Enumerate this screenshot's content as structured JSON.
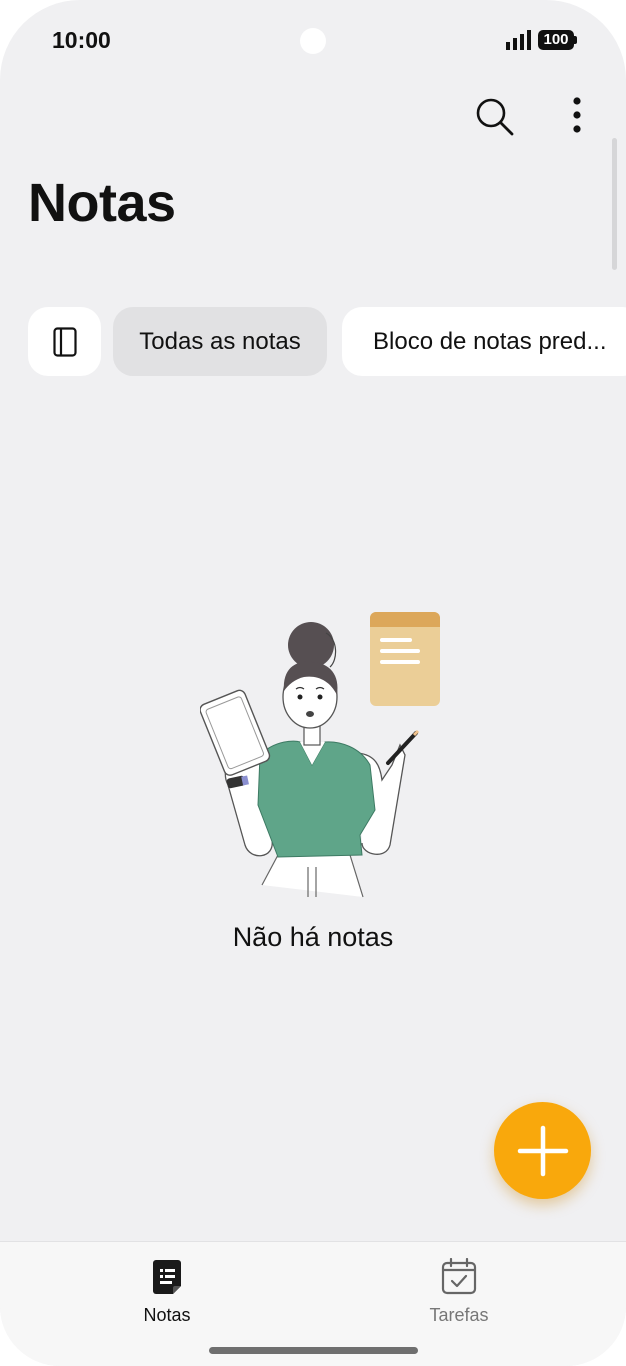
{
  "status": {
    "time": "10:00",
    "battery": "100"
  },
  "header": {
    "title": "Notas"
  },
  "filters": {
    "all_notes": "Todas as notas",
    "default_notebook": "Bloco de notas pred..."
  },
  "empty_state": {
    "message": "Não há notas"
  },
  "bottom_nav": {
    "items": [
      {
        "label": "Notas",
        "icon": "note-icon",
        "active": true
      },
      {
        "label": "Tarefas",
        "icon": "calendar-check-icon",
        "active": false
      }
    ]
  },
  "colors": {
    "accent": "#f9a80c",
    "background": "#f0f0f2",
    "active_chip": "#e1e1e3"
  }
}
